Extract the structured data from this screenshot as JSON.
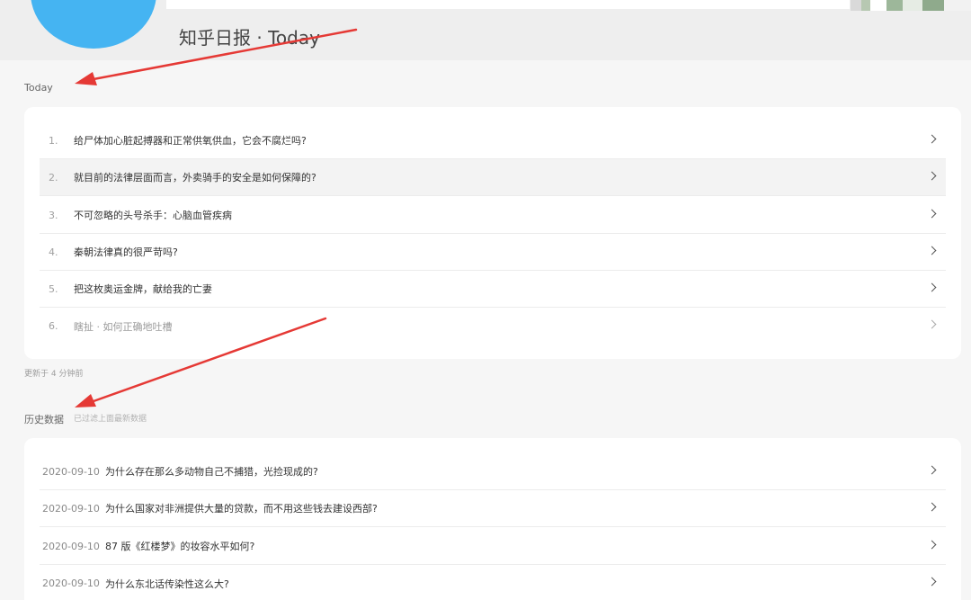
{
  "header": {
    "site_title": "知乎日报 · Today"
  },
  "today": {
    "label": "Today",
    "items": [
      {
        "num": "1.",
        "title": "给尸体加心脏起搏器和正常供氧供血，它会不腐烂吗?"
      },
      {
        "num": "2.",
        "title": "就目前的法律层面而言，外卖骑手的安全是如何保障的?"
      },
      {
        "num": "3.",
        "title": "不可忽略的头号杀手：心脑血管疾病"
      },
      {
        "num": "4.",
        "title": "秦朝法律真的很严苛吗?"
      },
      {
        "num": "5.",
        "title": "把这枚奥运金牌，献给我的亡妻"
      },
      {
        "num": "6.",
        "title": "瞎扯 · 如何正确地吐槽"
      }
    ],
    "update_note": "更新于 4 分钟前"
  },
  "history": {
    "label": "历史数据",
    "hint": "已过滤上面最新数据",
    "items": [
      {
        "date": "2020-09-10",
        "title": "为什么存在那么多动物自己不捕猎，光捡现成的?"
      },
      {
        "date": "2020-09-10",
        "title": "为什么国家对非洲提供大量的贷款，而不用这些钱去建设西部?"
      },
      {
        "date": "2020-09-10",
        "title": "87 版《红楼梦》的妆容水平如何?"
      },
      {
        "date": "2020-09-10",
        "title": "为什么东北话传染性这么大?"
      }
    ]
  },
  "colors": {
    "logo": "#45b4f2",
    "arrow": "#e53935",
    "hover_row": "#f3f3f3"
  }
}
